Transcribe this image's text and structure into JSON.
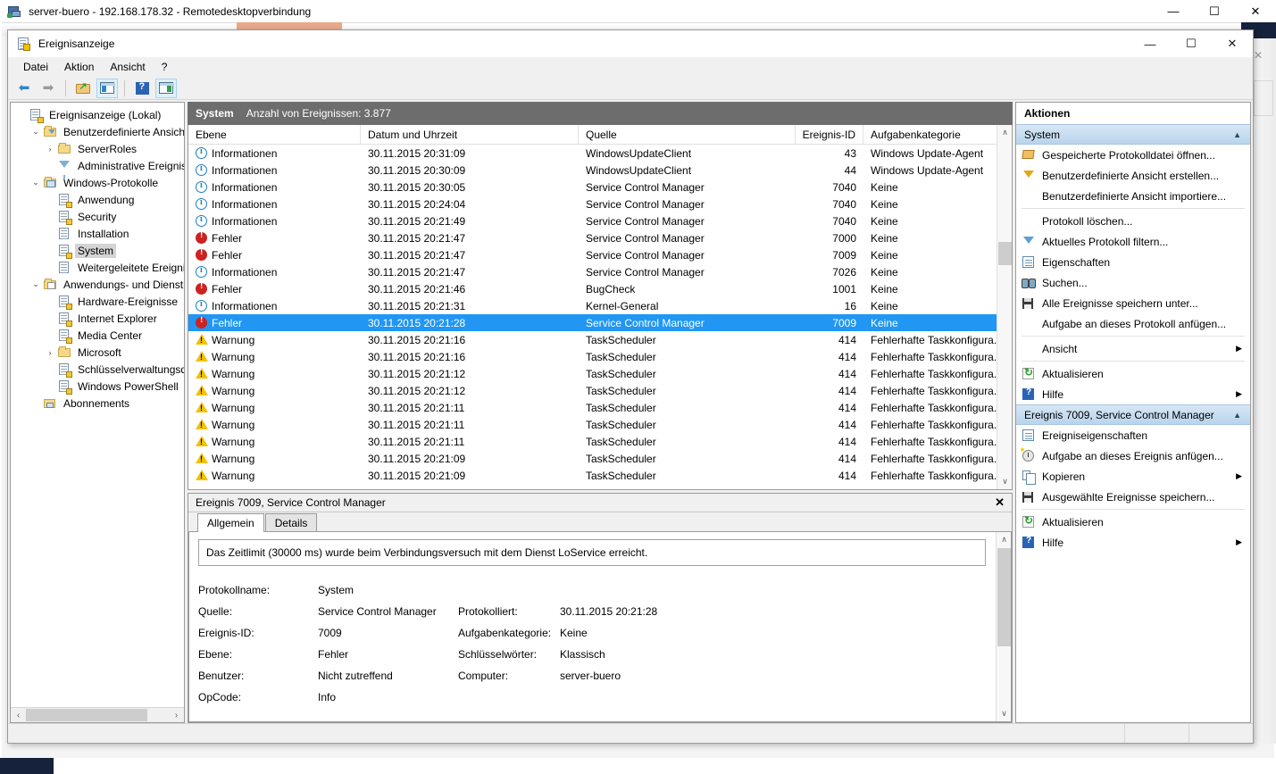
{
  "rdp": {
    "title": "server-buero - 192.168.178.32 - Remotedesktopverbindung",
    "minimize": "—",
    "maximize": "☐",
    "close": "✕"
  },
  "window": {
    "title": "Ereignisanzeige",
    "minimize": "—",
    "maximize": "☐",
    "close": "✕"
  },
  "menu": {
    "items": [
      "Datei",
      "Aktion",
      "Ansicht",
      "?"
    ]
  },
  "toolbar": {
    "buttons": [
      {
        "name": "back-icon",
        "glyph": "⬅"
      },
      {
        "name": "forward-icon",
        "glyph": "➡"
      },
      {
        "name": "up-folder-icon",
        "glyph": ""
      },
      {
        "name": "show-hide-tree-icon",
        "glyph": ""
      },
      {
        "name": "help-icon",
        "glyph": "?"
      },
      {
        "name": "show-hide-action-pane-icon",
        "glyph": ""
      }
    ]
  },
  "tree": {
    "items": [
      {
        "label": "Ereignisanzeige (Lokal)",
        "indent": 0,
        "chevron": "",
        "icon": "event-viewer-icon",
        "selected": false
      },
      {
        "label": "Benutzerdefinierte Ansichten",
        "indent": 1,
        "chevron": "⌄",
        "icon": "custom-views-folder-icon",
        "selected": false
      },
      {
        "label": "ServerRoles",
        "indent": 2,
        "chevron": "›",
        "icon": "folder-icon",
        "selected": false
      },
      {
        "label": "Administrative Ereignisse",
        "indent": 2,
        "chevron": "",
        "icon": "filter-funnel-icon",
        "selected": false
      },
      {
        "label": "Windows-Protokolle",
        "indent": 1,
        "chevron": "⌄",
        "icon": "windows-logs-icon",
        "selected": false
      },
      {
        "label": "Anwendung",
        "indent": 2,
        "chevron": "",
        "icon": "log-icon",
        "selected": false
      },
      {
        "label": "Security",
        "indent": 2,
        "chevron": "",
        "icon": "log-icon",
        "selected": false
      },
      {
        "label": "Installation",
        "indent": 2,
        "chevron": "",
        "icon": "log-plain-icon",
        "selected": false
      },
      {
        "label": "System",
        "indent": 2,
        "chevron": "",
        "icon": "log-icon",
        "selected": true
      },
      {
        "label": "Weitergeleitete Ereignisse",
        "indent": 2,
        "chevron": "",
        "icon": "log-plain-icon",
        "selected": false
      },
      {
        "label": "Anwendungs- und Dienstprotokolle",
        "indent": 1,
        "chevron": "⌄",
        "icon": "app-service-logs-icon",
        "selected": false
      },
      {
        "label": "Hardware-Ereignisse",
        "indent": 2,
        "chevron": "",
        "icon": "log-icon",
        "selected": false
      },
      {
        "label": "Internet Explorer",
        "indent": 2,
        "chevron": "",
        "icon": "log-icon",
        "selected": false
      },
      {
        "label": "Media Center",
        "indent": 2,
        "chevron": "",
        "icon": "log-icon",
        "selected": false
      },
      {
        "label": "Microsoft",
        "indent": 2,
        "chevron": "›",
        "icon": "folder-icon",
        "selected": false
      },
      {
        "label": "Schlüsselverwaltungsdienst",
        "indent": 2,
        "chevron": "",
        "icon": "log-icon",
        "selected": false
      },
      {
        "label": "Windows PowerShell",
        "indent": 2,
        "chevron": "",
        "icon": "log-icon",
        "selected": false
      },
      {
        "label": "Abonnements",
        "indent": 1,
        "chevron": "",
        "icon": "subscriptions-icon",
        "selected": false
      }
    ]
  },
  "list": {
    "header_title": "System",
    "header_count": "Anzahl von Ereignissen: 3.877",
    "columns": [
      "Ebene",
      "Datum und Uhrzeit",
      "Quelle",
      "Ereignis-ID",
      "Aufgabenkategorie"
    ],
    "rows": [
      {
        "level": "Informationen",
        "icon": "information-icon",
        "date": "30.11.2015 20:31:09",
        "source": "WindowsUpdateClient",
        "id": "43",
        "category": "Windows Update-Agent",
        "selected": false
      },
      {
        "level": "Informationen",
        "icon": "information-icon",
        "date": "30.11.2015 20:30:09",
        "source": "WindowsUpdateClient",
        "id": "44",
        "category": "Windows Update-Agent",
        "selected": false
      },
      {
        "level": "Informationen",
        "icon": "information-icon",
        "date": "30.11.2015 20:30:05",
        "source": "Service Control Manager",
        "id": "7040",
        "category": "Keine",
        "selected": false
      },
      {
        "level": "Informationen",
        "icon": "information-icon",
        "date": "30.11.2015 20:24:04",
        "source": "Service Control Manager",
        "id": "7040",
        "category": "Keine",
        "selected": false
      },
      {
        "level": "Informationen",
        "icon": "information-icon",
        "date": "30.11.2015 20:21:49",
        "source": "Service Control Manager",
        "id": "7040",
        "category": "Keine",
        "selected": false
      },
      {
        "level": "Fehler",
        "icon": "error-icon",
        "date": "30.11.2015 20:21:47",
        "source": "Service Control Manager",
        "id": "7000",
        "category": "Keine",
        "selected": false
      },
      {
        "level": "Fehler",
        "icon": "error-icon",
        "date": "30.11.2015 20:21:47",
        "source": "Service Control Manager",
        "id": "7009",
        "category": "Keine",
        "selected": false
      },
      {
        "level": "Informationen",
        "icon": "information-icon",
        "date": "30.11.2015 20:21:47",
        "source": "Service Control Manager",
        "id": "7026",
        "category": "Keine",
        "selected": false
      },
      {
        "level": "Fehler",
        "icon": "error-icon",
        "date": "30.11.2015 20:21:46",
        "source": "BugCheck",
        "id": "1001",
        "category": "Keine",
        "selected": false
      },
      {
        "level": "Informationen",
        "icon": "information-icon",
        "date": "30.11.2015 20:21:31",
        "source": "Kernel-General",
        "id": "16",
        "category": "Keine",
        "selected": false
      },
      {
        "level": "Fehler",
        "icon": "error-icon",
        "date": "30.11.2015 20:21:28",
        "source": "Service Control Manager",
        "id": "7009",
        "category": "Keine",
        "selected": true
      },
      {
        "level": "Warnung",
        "icon": "warning-icon",
        "date": "30.11.2015 20:21:16",
        "source": "TaskScheduler",
        "id": "414",
        "category": "Fehlerhafte Taskkonfigura...",
        "selected": false
      },
      {
        "level": "Warnung",
        "icon": "warning-icon",
        "date": "30.11.2015 20:21:16",
        "source": "TaskScheduler",
        "id": "414",
        "category": "Fehlerhafte Taskkonfigura...",
        "selected": false
      },
      {
        "level": "Warnung",
        "icon": "warning-icon",
        "date": "30.11.2015 20:21:12",
        "source": "TaskScheduler",
        "id": "414",
        "category": "Fehlerhafte Taskkonfigura...",
        "selected": false
      },
      {
        "level": "Warnung",
        "icon": "warning-icon",
        "date": "30.11.2015 20:21:12",
        "source": "TaskScheduler",
        "id": "414",
        "category": "Fehlerhafte Taskkonfigura...",
        "selected": false
      },
      {
        "level": "Warnung",
        "icon": "warning-icon",
        "date": "30.11.2015 20:21:11",
        "source": "TaskScheduler",
        "id": "414",
        "category": "Fehlerhafte Taskkonfigura...",
        "selected": false
      },
      {
        "level": "Warnung",
        "icon": "warning-icon",
        "date": "30.11.2015 20:21:11",
        "source": "TaskScheduler",
        "id": "414",
        "category": "Fehlerhafte Taskkonfigura...",
        "selected": false
      },
      {
        "level": "Warnung",
        "icon": "warning-icon",
        "date": "30.11.2015 20:21:11",
        "source": "TaskScheduler",
        "id": "414",
        "category": "Fehlerhafte Taskkonfigura...",
        "selected": false
      },
      {
        "level": "Warnung",
        "icon": "warning-icon",
        "date": "30.11.2015 20:21:09",
        "source": "TaskScheduler",
        "id": "414",
        "category": "Fehlerhafte Taskkonfigura...",
        "selected": false
      },
      {
        "level": "Warnung",
        "icon": "warning-icon",
        "date": "30.11.2015 20:21:09",
        "source": "TaskScheduler",
        "id": "414",
        "category": "Fehlerhafte Taskkonfigura...",
        "selected": false
      }
    ]
  },
  "detail": {
    "header": "Ereignis 7009, Service Control Manager",
    "close": "✕",
    "tabs": [
      {
        "label": "Allgemein",
        "active": true
      },
      {
        "label": "Details",
        "active": false
      }
    ],
    "message": "Das Zeitlimit (30000 ms) wurde beim Verbindungsversuch mit dem Dienst LoService erreicht.",
    "properties": [
      {
        "label": "Protokollname:",
        "value": "System",
        "label2": "",
        "value2": ""
      },
      {
        "label": "Quelle:",
        "value": "Service Control Manager",
        "label2": "Protokolliert:",
        "value2": "30.11.2015 20:21:28"
      },
      {
        "label": "Ereignis-ID:",
        "value": "7009",
        "label2": "Aufgabenkategorie:",
        "value2": "Keine"
      },
      {
        "label": "Ebene:",
        "value": "Fehler",
        "label2": "Schlüsselwörter:",
        "value2": "Klassisch"
      },
      {
        "label": "Benutzer:",
        "value": "Nicht zutreffend",
        "label2": "Computer:",
        "value2": "server-buero"
      },
      {
        "label": "OpCode:",
        "value": "Info",
        "label2": "",
        "value2": ""
      }
    ]
  },
  "actions": {
    "title": "Aktionen",
    "groups": [
      {
        "header": "System",
        "collapse": "▲",
        "items": [
          {
            "label": "Gespeicherte Protokolldatei öffnen...",
            "icon": "open-folder-icon",
            "submenu": "",
            "sep_after": false
          },
          {
            "label": "Benutzerdefinierte Ansicht erstellen...",
            "icon": "filter-funnel-yellow-icon",
            "submenu": "",
            "sep_after": false
          },
          {
            "label": "Benutzerdefinierte Ansicht importiere...",
            "icon": "",
            "submenu": "",
            "sep_after": true
          },
          {
            "label": "Protokoll löschen...",
            "icon": "",
            "submenu": "",
            "sep_after": false
          },
          {
            "label": "Aktuelles Protokoll filtern...",
            "icon": "filter-funnel-blue-icon",
            "submenu": "",
            "sep_after": false
          },
          {
            "label": "Eigenschaften",
            "icon": "properties-icon",
            "submenu": "",
            "sep_after": false
          },
          {
            "label": "Suchen...",
            "icon": "find-binoculars-icon",
            "submenu": "",
            "sep_after": false
          },
          {
            "label": "Alle Ereignisse speichern unter...",
            "icon": "save-icon",
            "submenu": "",
            "sep_after": false
          },
          {
            "label": "Aufgabe an dieses Protokoll anfügen...",
            "icon": "",
            "submenu": "",
            "sep_after": true
          },
          {
            "label": "Ansicht",
            "icon": "",
            "submenu": "▶",
            "sep_after": true
          },
          {
            "label": "Aktualisieren",
            "icon": "refresh-icon",
            "submenu": "",
            "sep_after": false
          },
          {
            "label": "Hilfe",
            "icon": "help-icon",
            "submenu": "▶",
            "sep_after": false
          }
        ]
      },
      {
        "header": "Ereignis 7009, Service Control Manager",
        "collapse": "▲",
        "items": [
          {
            "label": "Ereigniseigenschaften",
            "icon": "properties-icon",
            "submenu": "",
            "sep_after": false
          },
          {
            "label": "Aufgabe an dieses Ereignis anfügen...",
            "icon": "attach-task-icon",
            "submenu": "",
            "sep_after": false
          },
          {
            "label": "Kopieren",
            "icon": "copy-icon",
            "submenu": "▶",
            "sep_after": false
          },
          {
            "label": "Ausgewählte Ereignisse speichern...",
            "icon": "save-icon",
            "submenu": "",
            "sep_after": true
          },
          {
            "label": "Aktualisieren",
            "icon": "refresh-icon",
            "submenu": "",
            "sep_after": false
          },
          {
            "label": "Hilfe",
            "icon": "help-icon",
            "submenu": "▶",
            "sep_after": false
          }
        ]
      }
    ]
  },
  "scroll": {
    "up_arrow": "∧",
    "down_arrow": "∨",
    "left_arrow": "‹",
    "right_arrow": "›"
  },
  "colors": {
    "selection_blue": "#2196f3",
    "header_gray": "#6d6d6d",
    "actions_group": "#b9d4ec",
    "error_red": "#cc2222",
    "warning_yellow": "#f2c200",
    "info_blue": "#1c7fc4"
  }
}
